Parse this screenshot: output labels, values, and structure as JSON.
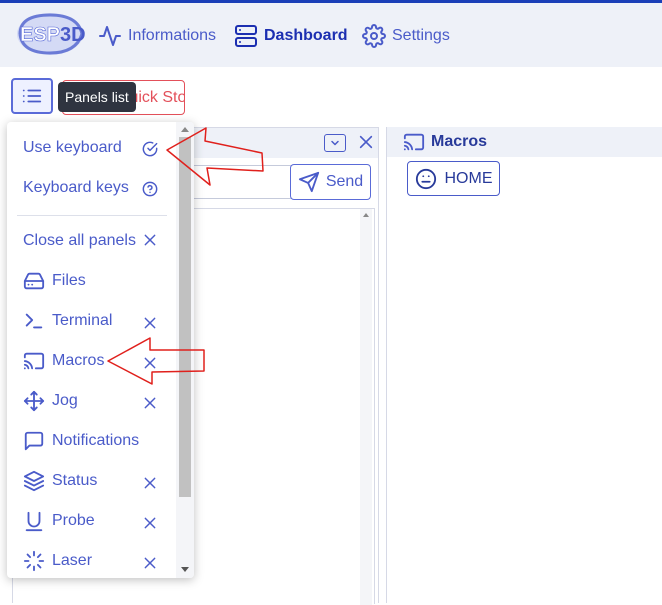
{
  "brand": {
    "logo_text": "ESP3D",
    "logo_left": "ESP",
    "logo_right": "3D"
  },
  "nav": {
    "informations": "Informations",
    "dashboard": "Dashboard",
    "settings": "Settings"
  },
  "toolbar": {
    "panels_tooltip": "Panels list",
    "estop_label": "Quick Stop"
  },
  "terminal": {
    "send_label": "Send",
    "input_value": ""
  },
  "macros": {
    "title": "Macros",
    "home_label": "HOME"
  },
  "dropdown": {
    "use_keyboard": "Use keyboard",
    "keyboard_keys": "Keyboard keys",
    "close_all": "Close all panels",
    "items": [
      {
        "label": "Files",
        "icon": "hard-drive-icon",
        "closable": false
      },
      {
        "label": "Terminal",
        "icon": "terminal-icon",
        "closable": true
      },
      {
        "label": "Macros",
        "icon": "cast-icon",
        "closable": true
      },
      {
        "label": "Jog",
        "icon": "move-icon",
        "closable": true
      },
      {
        "label": "Notifications",
        "icon": "message-square-icon",
        "closable": false
      },
      {
        "label": "Status",
        "icon": "layers-icon",
        "closable": true
      },
      {
        "label": "Probe",
        "icon": "magnet-icon",
        "closable": true
      },
      {
        "label": "Laser",
        "icon": "loader-icon",
        "closable": true
      }
    ]
  },
  "colors": {
    "accent": "#4a5bc9",
    "accent_dark": "#1c2fb1",
    "danger": "#e3505a",
    "annotation_arrow": "#e0201c"
  }
}
